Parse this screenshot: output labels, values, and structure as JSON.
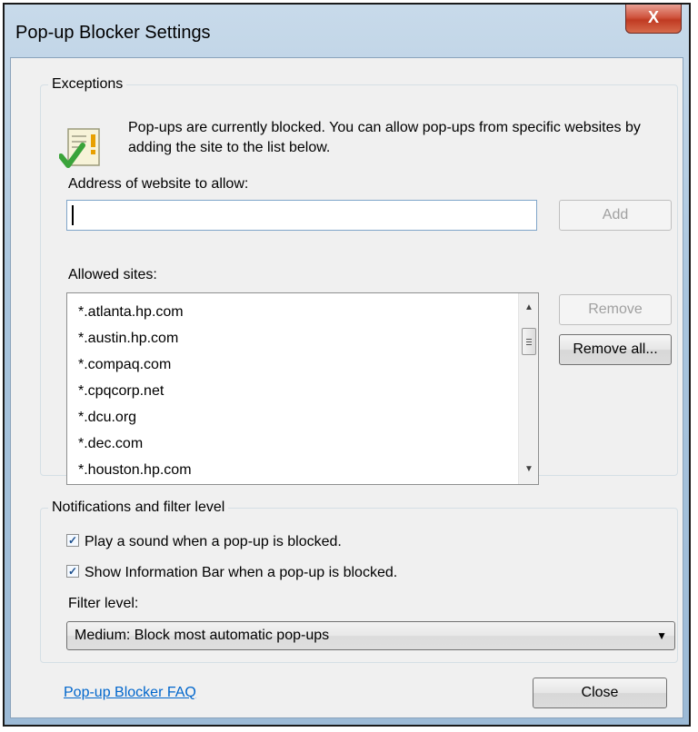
{
  "window": {
    "title": "Pop-up Blocker Settings",
    "close_glyph": "X"
  },
  "exceptions": {
    "legend": "Exceptions",
    "info_text": "Pop-ups are currently blocked.  You can allow pop-ups from specific websites by adding the site to the list below.",
    "address_label": "Address of website to allow:",
    "address_value": "",
    "add_button": "Add",
    "allowed_label": "Allowed sites:",
    "sites": [
      "*.atlanta.hp.com",
      "*.austin.hp.com",
      "*.compaq.com",
      "*.cpqcorp.net",
      "*.dcu.org",
      "*.dec.com",
      "*.houston.hp.com"
    ],
    "remove_button": "Remove",
    "remove_all_button": "Remove all..."
  },
  "notifications": {
    "legend": "Notifications and filter level",
    "play_sound": {
      "label": "Play a sound when a pop-up is blocked.",
      "checked": true
    },
    "show_info_bar": {
      "label": "Show Information Bar when a pop-up is blocked.",
      "checked": true
    },
    "filter_label": "Filter level:",
    "filter_value": "Medium: Block most automatic pop-ups"
  },
  "footer": {
    "faq_link": "Pop-up Blocker FAQ",
    "close_button": "Close"
  },
  "icons": {
    "info": "shield-check-icon",
    "scroll_up": "scroll-up-arrow-icon",
    "scroll_down": "scroll-down-arrow-icon",
    "dropdown": "chevron-down-icon"
  }
}
